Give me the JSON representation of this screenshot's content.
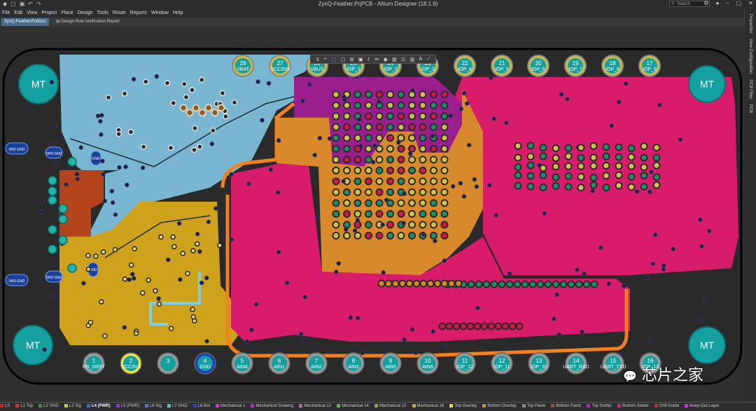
{
  "window": {
    "title": "ZynQ-Feather.PrjPCB - Altium Designer (18.1.9)",
    "search_placeholder": "Search"
  },
  "menu": [
    "File",
    "Edit",
    "View",
    "Project",
    "Place",
    "Design",
    "Tools",
    "Route",
    "Reports",
    "Window",
    "Help"
  ],
  "tabs": [
    {
      "label": "ZynQ-Feather.PcbDoc",
      "active": true
    },
    {
      "label": "Design Rule Verification Report",
      "active": false
    }
  ],
  "right_panel": [
    "Properties",
    "View Configuration",
    "PCB Filter",
    "PCB"
  ],
  "pcb": {
    "mounting_holes": [
      "MT",
      "MT",
      "MT",
      "MT"
    ],
    "top_pins": [
      {
        "num": "28",
        "name": "VBAT"
      },
      {
        "num": "27",
        "name": "VCC3V3"
      },
      {
        "num": "26",
        "name": "VBUS"
      },
      {
        "num": "25",
        "name": "IOP_1"
      },
      {
        "num": "24",
        "name": "IOP_2"
      },
      {
        "num": "23",
        "name": "IOP_3"
      },
      {
        "num": "22",
        "name": "IOP_4"
      },
      {
        "num": "21",
        "name": "IOP_5"
      },
      {
        "num": "20",
        "name": "IOP_6"
      },
      {
        "num": "19",
        "name": "IOP_7"
      },
      {
        "num": "18",
        "name": "IOP_8"
      },
      {
        "num": "17",
        "name": "IOP_9"
      }
    ],
    "bottom_pins": [
      {
        "num": "1",
        "name": "PB_SRST"
      },
      {
        "num": "2",
        "name": "VCC3V3"
      },
      {
        "num": "3",
        "name": ""
      },
      {
        "num": "4",
        "name": "GND"
      },
      {
        "num": "5",
        "name": "AIN4"
      },
      {
        "num": "6",
        "name": "AIN1"
      },
      {
        "num": "7",
        "name": "AIN2"
      },
      {
        "num": "8",
        "name": "AIN3"
      },
      {
        "num": "9",
        "name": "AIN5"
      },
      {
        "num": "10",
        "name": "AIN6"
      },
      {
        "num": "11",
        "name": "IOP_12"
      },
      {
        "num": "12",
        "name": "IOP_11"
      },
      {
        "num": "13",
        "name": "IOP_10"
      },
      {
        "num": "14",
        "name": "UART_RXD"
      },
      {
        "num": "15",
        "name": "UART_TXD"
      },
      {
        "num": "16",
        "name": "IOP_13"
      }
    ],
    "shield_labels": [
      "SHD GND",
      "SHD GND",
      "SHD GND",
      "SHD GND"
    ],
    "small_labels": [
      "GND",
      "GND"
    ]
  },
  "status_layers": [
    {
      "name": "LS",
      "color": "#d02020"
    },
    {
      "name": "L1 Top",
      "color": "#e03030"
    },
    {
      "name": "L2 GND",
      "color": "#3a9a3a"
    },
    {
      "name": "L3 Sig",
      "color": "#c8c83a"
    },
    {
      "name": "L4 (PWR)",
      "color": "#3a6ad0"
    },
    {
      "name": "L5 (PWR)",
      "color": "#8a3ad0"
    },
    {
      "name": "L6 Sig",
      "color": "#6a6ad0"
    },
    {
      "name": "L7 GND",
      "color": "#3ad0d0"
    },
    {
      "name": "L8 Bot",
      "color": "#3a3ad0"
    },
    {
      "name": "Mechanical 1",
      "color": "#d03ad0"
    },
    {
      "name": "Mechanical Drawing",
      "color": "#a03aa0"
    },
    {
      "name": "Mechanical 13",
      "color": "#d060a0"
    },
    {
      "name": "Mechanical 14",
      "color": "#3ad03a"
    },
    {
      "name": "Mechanical 15",
      "color": "#a0a03a"
    },
    {
      "name": "Mechanical 16",
      "color": "#d0a03a"
    },
    {
      "name": "Top Overlay",
      "color": "#e0e040"
    },
    {
      "name": "Bottom Overlay",
      "color": "#d09030"
    },
    {
      "name": "Top Paste",
      "color": "#888888"
    },
    {
      "name": "Bottom Paste",
      "color": "#a05030"
    },
    {
      "name": "Top Solder",
      "color": "#a030a0"
    },
    {
      "name": "Bottom Solder",
      "color": "#c03080"
    },
    {
      "name": "Drill Guide",
      "color": "#c03030"
    },
    {
      "name": "Keep-Out Layer",
      "color": "#d030d0"
    }
  ],
  "watermark": "芯片之家"
}
